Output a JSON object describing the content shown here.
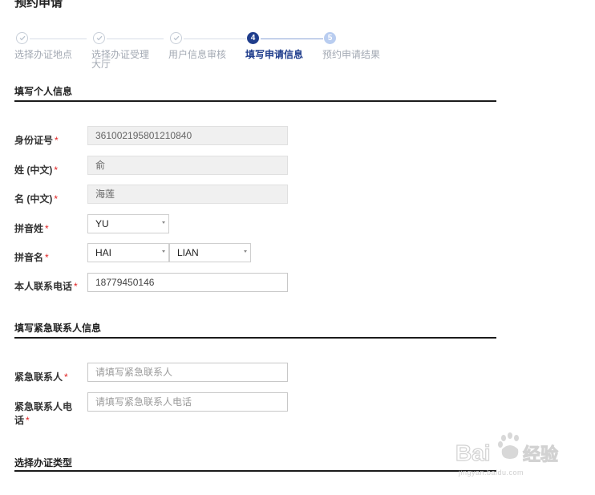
{
  "page": {
    "title": "预约申请"
  },
  "stepper": {
    "steps": [
      {
        "label": "选择办证地点",
        "state": "done"
      },
      {
        "label": "选择办证受理大厅",
        "label_line1": "选择办证受理",
        "label_line2": "大厅",
        "state": "done"
      },
      {
        "label": "用户信息审核",
        "state": "done"
      },
      {
        "number": "4",
        "label": "填写申请信息",
        "state": "active"
      },
      {
        "number": "5",
        "label": "预约申请结果",
        "state": "pending"
      }
    ]
  },
  "sections": {
    "personal": {
      "title": "填写个人信息"
    },
    "emergency": {
      "title": "填写紧急联系人信息"
    },
    "type": {
      "title": "选择办证类型"
    }
  },
  "form": {
    "required_mark": "*",
    "id_number": {
      "label": "身份证号",
      "value": "361002195801210840"
    },
    "surname_cn": {
      "label": "姓 (中文)",
      "value": "俞"
    },
    "given_cn": {
      "label": "名 (中文)",
      "value": "海莲"
    },
    "surname_pinyin": {
      "label": "拼音姓",
      "value": "YU"
    },
    "given_pinyin": {
      "label": "拼音名",
      "value1": "HAI",
      "value2": "LIAN"
    },
    "phone": {
      "label": "本人联系电话",
      "value": "18779450146"
    },
    "emergency_contact": {
      "label": "紧急联系人",
      "placeholder": "请填写紧急联系人"
    },
    "emergency_phone": {
      "label_line1": "紧急联系人电",
      "label_line2": "话",
      "placeholder": "请填写紧急联系人电话"
    }
  },
  "watermark": {
    "brand": "Bai经验",
    "url": "jingyan.baidu.com"
  },
  "colors": {
    "accent": "#1f3d8c",
    "pending": "#b9cdf0",
    "required": "#e02020",
    "rule": "#1b1b1b"
  }
}
